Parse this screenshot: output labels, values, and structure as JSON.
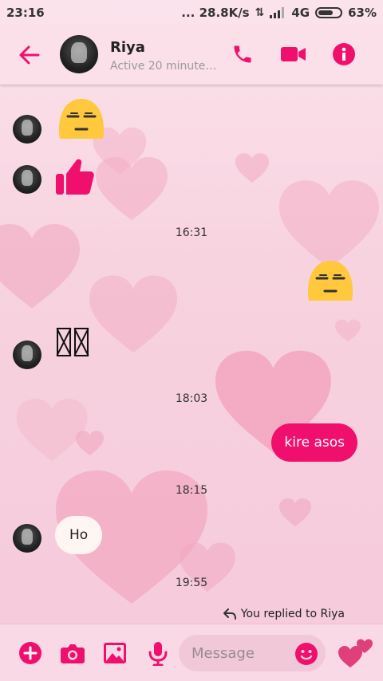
{
  "status_bar": {
    "time": "23:16",
    "network_speed": "... 28.8K/s",
    "network_type": "4G",
    "battery": "63%"
  },
  "header": {
    "contact_name": "Riya",
    "contact_status": "Active 20 minutes a..."
  },
  "conversation": {
    "timestamps": [
      "16:31",
      "18:03",
      "18:15",
      "19:55"
    ],
    "outgoing_message": "kire asos",
    "incoming_message": "Ho",
    "reply_note": "You replied to Riya"
  },
  "composer": {
    "placeholder": "Message"
  },
  "colors": {
    "accent": "#f00f6d",
    "background": "#f8d6e3",
    "emoji_yellow": "#ffc83d"
  },
  "icons": [
    "back-arrow-icon",
    "phone-icon",
    "video-camera-icon",
    "info-icon",
    "plus-icon",
    "camera-icon",
    "image-icon",
    "microphone-icon",
    "smiley-icon",
    "hearts-icon",
    "reply-arrow-icon"
  ]
}
